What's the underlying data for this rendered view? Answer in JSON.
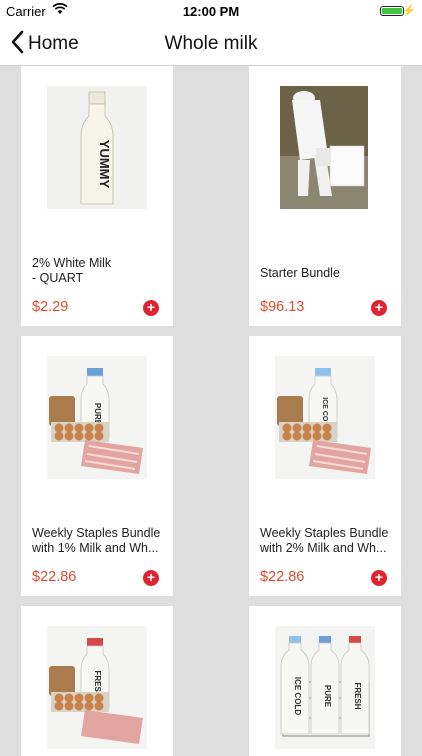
{
  "status_bar": {
    "carrier": "Carrier",
    "time": "12:00 PM"
  },
  "nav": {
    "back_label": "Home",
    "title": "Whole milk"
  },
  "products": [
    {
      "name": "2% White Milk\n- QUART",
      "price": "$2.29"
    },
    {
      "name": "Starter Bundle",
      "price": "$96.13"
    },
    {
      "name": "Weekly Staples Bundle with 1% Milk and Wh...",
      "price": "$22.86"
    },
    {
      "name": "Weekly Staples Bundle with 2% Milk and Wh...",
      "price": "$22.86"
    },
    {
      "name": "",
      "price": ""
    },
    {
      "name": "",
      "price": ""
    }
  ],
  "images": {
    "quart_label": "YUMMY",
    "label_pure": "PURE",
    "label_ice_cold": "ICE COLD",
    "label_fresh": "FRESH"
  },
  "colors": {
    "price": "#dd4b2e",
    "add_button": "#e0232e",
    "battery": "#3ec63e"
  }
}
